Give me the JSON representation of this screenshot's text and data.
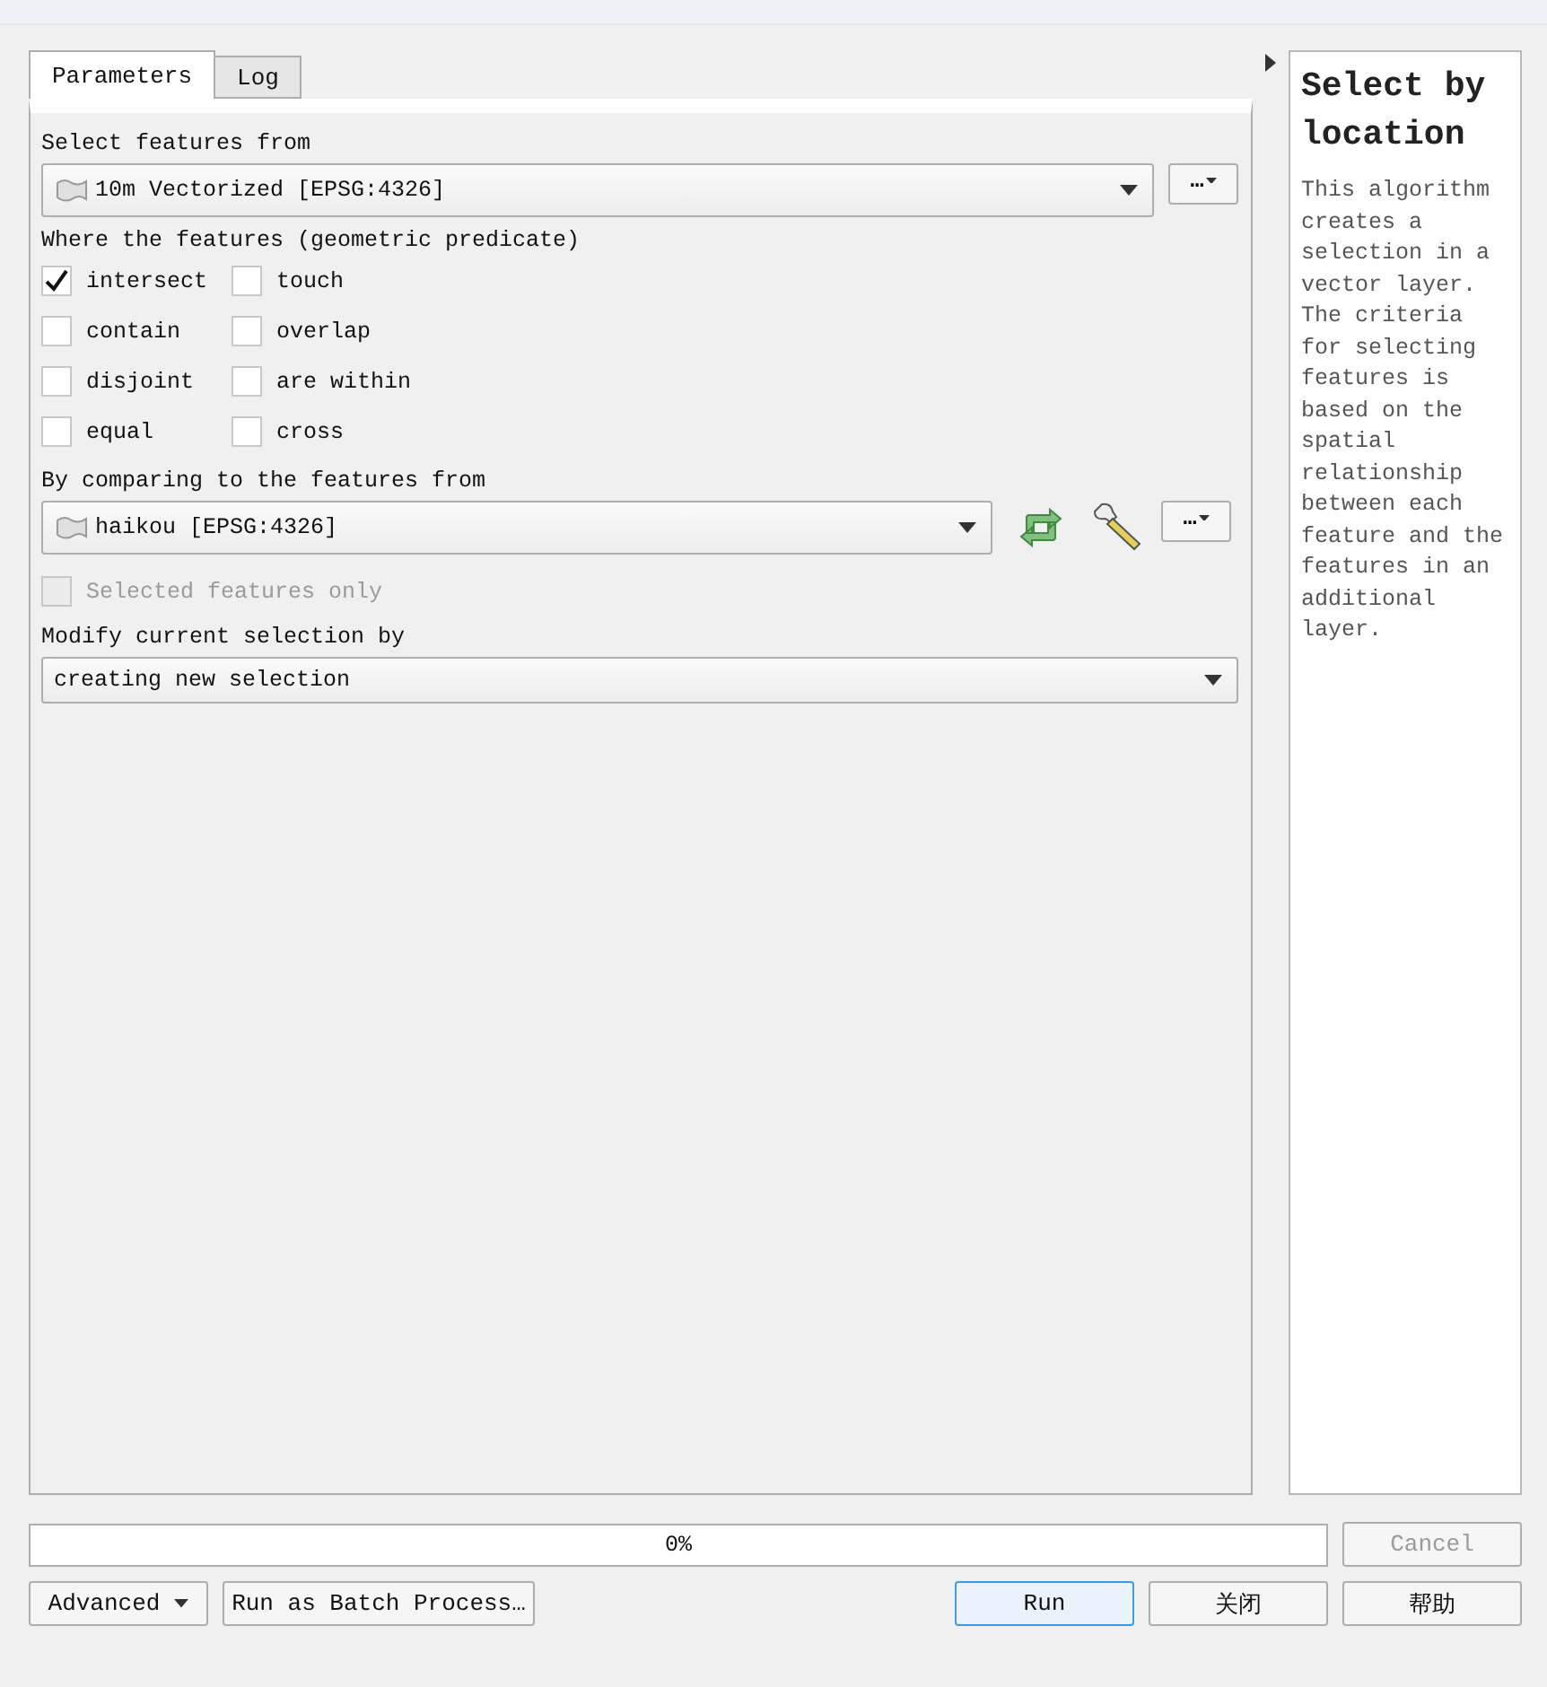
{
  "tabs": [
    {
      "label": "Parameters",
      "selected": true
    },
    {
      "label": "Log",
      "selected": false
    }
  ],
  "source": {
    "label": "Select features from",
    "value": "10m Vectorized [EPSG:4326]",
    "more": "…"
  },
  "predicate": {
    "label": "Where the features (geometric predicate)",
    "options": [
      {
        "label": "intersect",
        "checked": true
      },
      {
        "label": "touch",
        "checked": false
      },
      {
        "label": "contain",
        "checked": false
      },
      {
        "label": "overlap",
        "checked": false
      },
      {
        "label": "disjoint",
        "checked": false
      },
      {
        "label": "are within",
        "checked": false
      },
      {
        "label": "equal",
        "checked": false
      },
      {
        "label": "cross",
        "checked": false
      }
    ]
  },
  "compare": {
    "label": "By comparing to the features from",
    "value": "haikou [EPSG:4326]",
    "more": "…"
  },
  "selected_only": {
    "label": "Selected features only",
    "checked": false,
    "disabled": true
  },
  "modify": {
    "label": "Modify current selection by",
    "value": "creating new selection"
  },
  "help": {
    "title": "Select by location",
    "text": "This algorithm creates a selection in a vector layer. The criteria for selecting features is based on the spatial relationship between each feature and the features in an additional layer."
  },
  "progress": {
    "level": 0,
    "reading": "0%"
  },
  "buttons": {
    "cancel": {
      "label": "Cancel",
      "disabled": true
    },
    "advanced": "Advanced",
    "batch": "Run as Batch Process…",
    "run": "Run",
    "close": "关闭",
    "help": "帮助"
  }
}
